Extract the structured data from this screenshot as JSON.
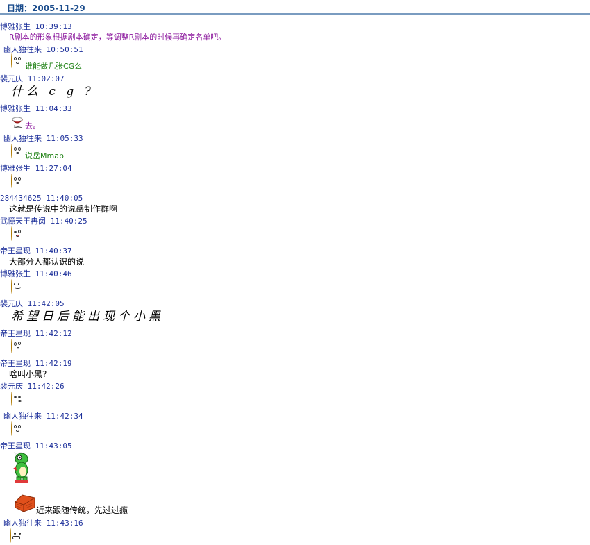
{
  "header": {
    "date_label": "日期：2005-11-29"
  },
  "messages": [
    {
      "header": "博雅张生 10:39:13",
      "text": "R剧本的形象根据剧本确定，等调整R剧本的时候再确定名单吧。"
    },
    {
      "header": "幽人独往来 10:50:51",
      "emoticon": "surprised-face-icon",
      "text": "谁能做几张CG么"
    },
    {
      "header": "裴元庆 11:02:07",
      "text": "什么 c g ?"
    },
    {
      "header": "博雅张生 11:04:33",
      "emoticon": "rice-bowl-icon",
      "text": "去。"
    },
    {
      "header": "幽人独往来 11:05:33",
      "emoticon": "surprised-face-icon",
      "text": "说岳Mmap"
    },
    {
      "header": "博雅张生 11:27:04",
      "emoticon": "surprised-face-icon"
    },
    {
      "header": "284434625 11:40:05",
      "text": "这就是传说中的说岳制作群啊"
    },
    {
      "header": "武憶天王冉闵 11:40:25",
      "emoticon": "wink-tongue-face-icon"
    },
    {
      "header": "帝王星现 11:40:37",
      "text": "大部分人都认识的说"
    },
    {
      "header": "博雅张生 11:40:46",
      "emoticon": "smile-face-icon"
    },
    {
      "header": "裴元庆 11:42:05",
      "text": "希望日后能出现个小黑"
    },
    {
      "header": "帝王星现 11:42:12",
      "emoticon": "confused-face-icon"
    },
    {
      "header": "帝王星现 11:42:19",
      "text": "啥叫小黑?"
    },
    {
      "header": "裴元庆 11:42:26",
      "emoticon": "thinking-face-icon"
    },
    {
      "header": "幽人独往来 11:42:34",
      "emoticon": "surprised-face-icon"
    },
    {
      "header": "帝王星现 11:43:05",
      "emoticon": "green-dragon-icon",
      "emoticon2": "red-brick-house-icon",
      "text": "近来跟随传统，先过过瘾"
    },
    {
      "header": "幽人独往来 11:43:16",
      "emoticon": "grin-face-icon"
    }
  ],
  "colors": {
    "header_text": "#1c2f9a",
    "date_text": "#1a4c8c",
    "purple_text": "#8a159c",
    "green_text": "#1b7f10",
    "divider": "#7a9cc0"
  }
}
